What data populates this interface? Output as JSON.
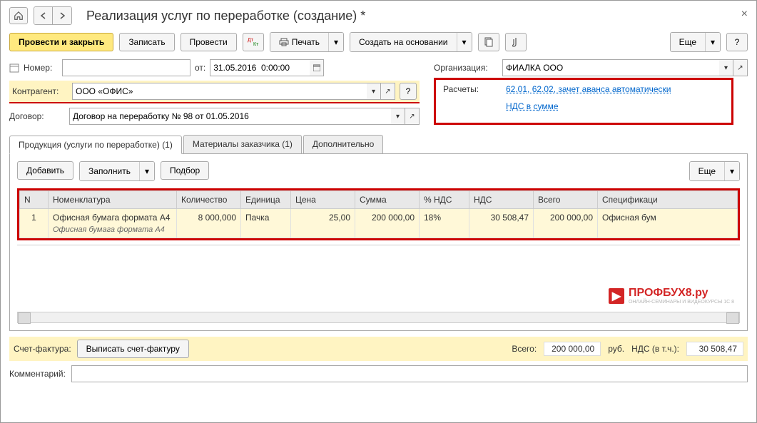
{
  "window": {
    "title": "Реализация услуг по переработке (создание) *"
  },
  "toolbar": {
    "post_close": "Провести и закрыть",
    "save": "Записать",
    "post": "Провести",
    "print": "Печать",
    "create_based": "Создать на основании",
    "more": "Еще",
    "help": "?"
  },
  "form": {
    "number_label": "Номер:",
    "number_value": "",
    "date_label": "от:",
    "date_value": "31.05.2016  0:00:00",
    "org_label": "Организация:",
    "org_value": "ФИАЛКА ООО",
    "contractor_label": "Контрагент:",
    "contractor_value": "ООО «ОФИС»",
    "contract_label": "Договор:",
    "contract_value": "Договор на переработку № 98 от 01.05.2016",
    "calc_label": "Расчеты:",
    "calc_link": "62.01, 62.02, зачет аванса автоматически",
    "vat_link": "НДС в сумме"
  },
  "tabs": {
    "t1": "Продукция (услуги по переработке) (1)",
    "t2": "Материалы заказчика (1)",
    "t3": "Дополнительно"
  },
  "tab_toolbar": {
    "add": "Добавить",
    "fill": "Заполнить",
    "pick": "Подбор",
    "more": "Еще"
  },
  "grid": {
    "headers": {
      "n": "N",
      "nom": "Номенклатура",
      "qty": "Количество",
      "unit": "Единица",
      "price": "Цена",
      "sum": "Сумма",
      "vat_pct": "% НДС",
      "vat": "НДС",
      "total": "Всего",
      "spec": "Спецификаци"
    },
    "rows": [
      {
        "n": "1",
        "nom": "Офисная бумага формата А4",
        "nom_sub": "Офисная бумага формата А4",
        "qty": "8 000,000",
        "unit": "Пачка",
        "price": "25,00",
        "sum": "200 000,00",
        "vat_pct": "18%",
        "vat": "30 508,47",
        "total": "200 000,00",
        "spec": "Офисная бум"
      }
    ]
  },
  "watermark": {
    "text": "ПРОФБУХ8.ру",
    "sub": "ОНЛАЙН-СЕМИНАРЫ И ВИДЕОКУРСЫ 1С 8"
  },
  "footer": {
    "invoice_label": "Счет-фактура:",
    "invoice_btn": "Выписать счет-фактуру",
    "total_label": "Всего:",
    "total_value": "200 000,00",
    "currency": "руб.",
    "vat_label": "НДС (в т.ч.):",
    "vat_value": "30 508,47",
    "comment_label": "Комментарий:",
    "comment_value": ""
  }
}
